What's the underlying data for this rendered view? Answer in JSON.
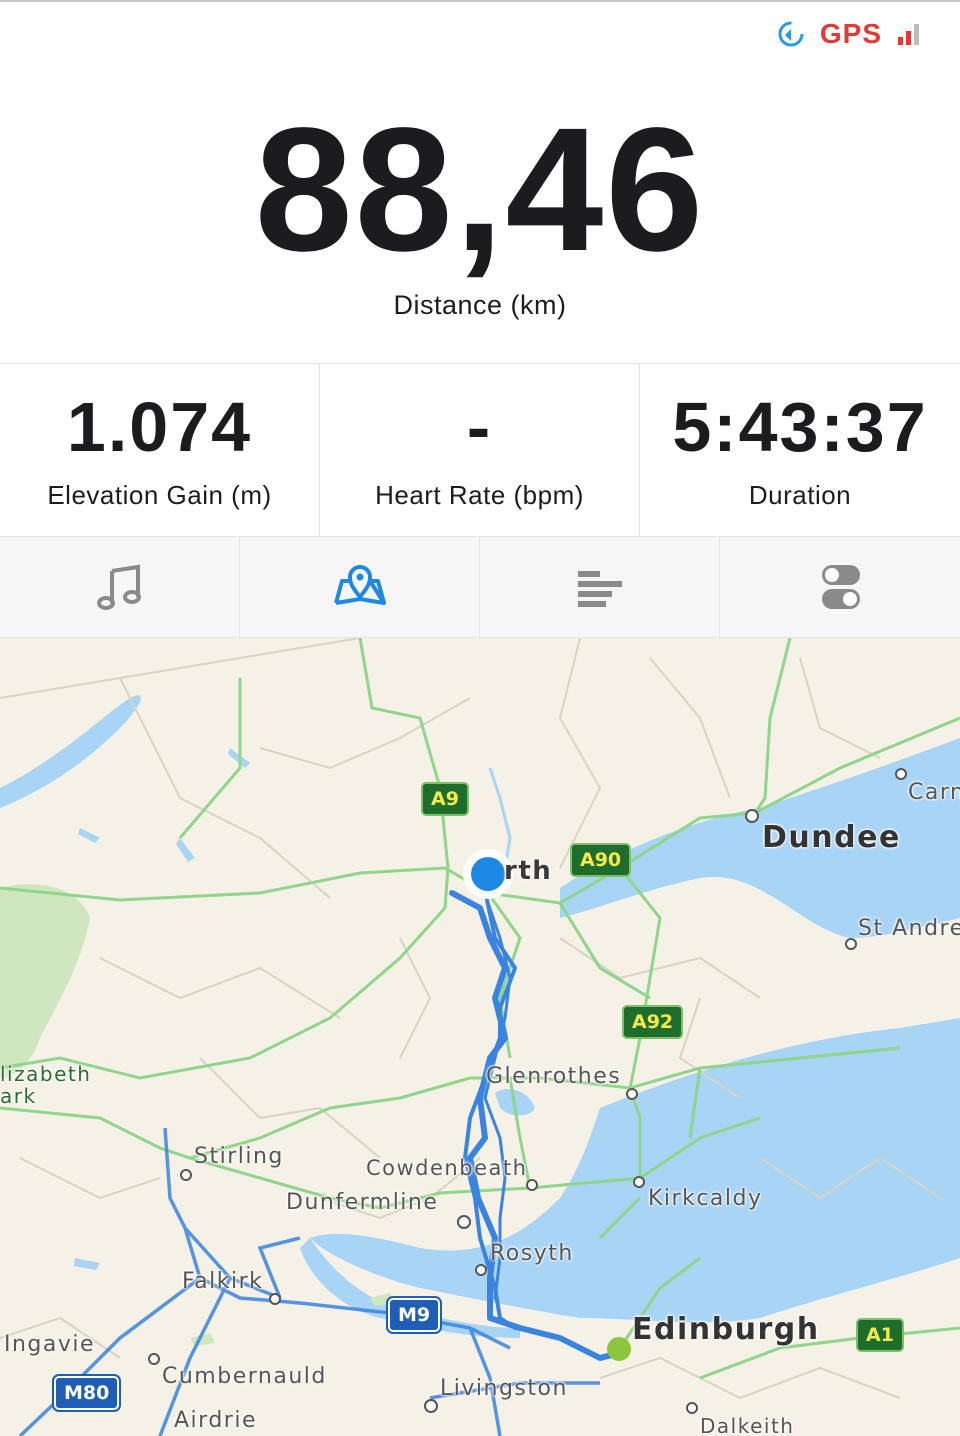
{
  "status": {
    "gps_label": "GPS",
    "sync_icon": "sync-icon",
    "signal_icon": "signal-bars-icon",
    "gps_color": "#e53935"
  },
  "distance": {
    "value": "88,46",
    "label": "Distance (km)"
  },
  "stats": [
    {
      "value": "1.074",
      "label": "Elevation Gain (m)"
    },
    {
      "value": "-",
      "label": "Heart Rate (bpm)"
    },
    {
      "value": "5:43:37",
      "label": "Duration"
    }
  ],
  "tabs": [
    {
      "icon": "music-note-icon",
      "active": false
    },
    {
      "icon": "map-pin-icon",
      "active": true
    },
    {
      "icon": "splits-list-icon",
      "active": false
    },
    {
      "icon": "toggle-settings-icon",
      "active": false
    }
  ],
  "colors": {
    "accent": "#1e88e5",
    "route": "#3a84e0",
    "water": "#a8d4f5",
    "land": "#f5f1e6",
    "roads": "#8fd68a"
  },
  "map": {
    "places": {
      "perth": "rth",
      "dundee": "Dundee",
      "carnoustie": "Carn",
      "st_andrews": "St Andre",
      "glenrothes": "Glenrothes",
      "stirling": "Stirling",
      "cowdenbeath": "Cowdenbeath",
      "dunfermline": "Dunfermline",
      "kirkcaldy": "Kirkcaldy",
      "rosyth": "Rosyth",
      "falkirk": "Falkirk",
      "edinburgh": "Edinburgh",
      "milngavie": "Ingavie",
      "cumbernauld": "Cumbernauld",
      "livingston": "Livingston",
      "airdrie": "Airdrie",
      "dalkeith": "Dalkeith",
      "park_line1": "lizabeth",
      "park_line2": "ark"
    },
    "roads": {
      "a9": "A9",
      "a90": "A90",
      "a92": "A92",
      "a1": "A1",
      "m9": "M9",
      "m80": "M80"
    }
  }
}
